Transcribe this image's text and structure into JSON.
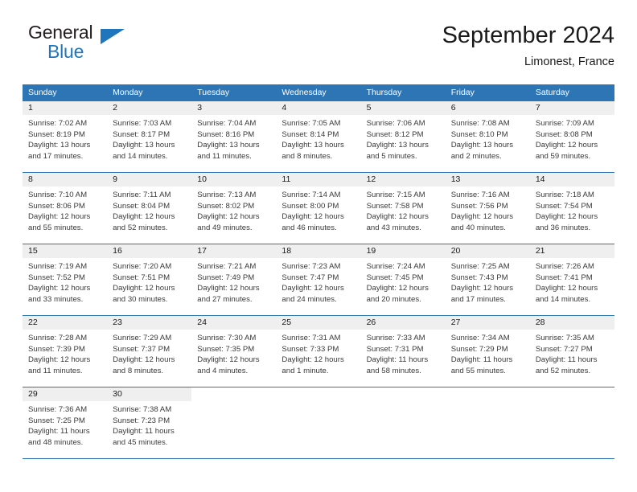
{
  "brand": {
    "name_part1": "General",
    "name_part2": "Blue",
    "logo_icon": "triangle-logo-icon"
  },
  "header": {
    "title": "September 2024",
    "location": "Limonest, France"
  },
  "calendar": {
    "weekday_headers": [
      "Sunday",
      "Monday",
      "Tuesday",
      "Wednesday",
      "Thursday",
      "Friday",
      "Saturday"
    ],
    "accent_color": "#2e75b6",
    "day_band_color": "#efefef",
    "weeks": [
      [
        {
          "day": "1",
          "lines": [
            "Sunrise: 7:02 AM",
            "Sunset: 8:19 PM",
            "Daylight: 13 hours",
            "and 17 minutes."
          ]
        },
        {
          "day": "2",
          "lines": [
            "Sunrise: 7:03 AM",
            "Sunset: 8:17 PM",
            "Daylight: 13 hours",
            "and 14 minutes."
          ]
        },
        {
          "day": "3",
          "lines": [
            "Sunrise: 7:04 AM",
            "Sunset: 8:16 PM",
            "Daylight: 13 hours",
            "and 11 minutes."
          ]
        },
        {
          "day": "4",
          "lines": [
            "Sunrise: 7:05 AM",
            "Sunset: 8:14 PM",
            "Daylight: 13 hours",
            "and 8 minutes."
          ]
        },
        {
          "day": "5",
          "lines": [
            "Sunrise: 7:06 AM",
            "Sunset: 8:12 PM",
            "Daylight: 13 hours",
            "and 5 minutes."
          ]
        },
        {
          "day": "6",
          "lines": [
            "Sunrise: 7:08 AM",
            "Sunset: 8:10 PM",
            "Daylight: 13 hours",
            "and 2 minutes."
          ]
        },
        {
          "day": "7",
          "lines": [
            "Sunrise: 7:09 AM",
            "Sunset: 8:08 PM",
            "Daylight: 12 hours",
            "and 59 minutes."
          ]
        }
      ],
      [
        {
          "day": "8",
          "lines": [
            "Sunrise: 7:10 AM",
            "Sunset: 8:06 PM",
            "Daylight: 12 hours",
            "and 55 minutes."
          ]
        },
        {
          "day": "9",
          "lines": [
            "Sunrise: 7:11 AM",
            "Sunset: 8:04 PM",
            "Daylight: 12 hours",
            "and 52 minutes."
          ]
        },
        {
          "day": "10",
          "lines": [
            "Sunrise: 7:13 AM",
            "Sunset: 8:02 PM",
            "Daylight: 12 hours",
            "and 49 minutes."
          ]
        },
        {
          "day": "11",
          "lines": [
            "Sunrise: 7:14 AM",
            "Sunset: 8:00 PM",
            "Daylight: 12 hours",
            "and 46 minutes."
          ]
        },
        {
          "day": "12",
          "lines": [
            "Sunrise: 7:15 AM",
            "Sunset: 7:58 PM",
            "Daylight: 12 hours",
            "and 43 minutes."
          ]
        },
        {
          "day": "13",
          "lines": [
            "Sunrise: 7:16 AM",
            "Sunset: 7:56 PM",
            "Daylight: 12 hours",
            "and 40 minutes."
          ]
        },
        {
          "day": "14",
          "lines": [
            "Sunrise: 7:18 AM",
            "Sunset: 7:54 PM",
            "Daylight: 12 hours",
            "and 36 minutes."
          ]
        }
      ],
      [
        {
          "day": "15",
          "lines": [
            "Sunrise: 7:19 AM",
            "Sunset: 7:52 PM",
            "Daylight: 12 hours",
            "and 33 minutes."
          ]
        },
        {
          "day": "16",
          "lines": [
            "Sunrise: 7:20 AM",
            "Sunset: 7:51 PM",
            "Daylight: 12 hours",
            "and 30 minutes."
          ]
        },
        {
          "day": "17",
          "lines": [
            "Sunrise: 7:21 AM",
            "Sunset: 7:49 PM",
            "Daylight: 12 hours",
            "and 27 minutes."
          ]
        },
        {
          "day": "18",
          "lines": [
            "Sunrise: 7:23 AM",
            "Sunset: 7:47 PM",
            "Daylight: 12 hours",
            "and 24 minutes."
          ]
        },
        {
          "day": "19",
          "lines": [
            "Sunrise: 7:24 AM",
            "Sunset: 7:45 PM",
            "Daylight: 12 hours",
            "and 20 minutes."
          ]
        },
        {
          "day": "20",
          "lines": [
            "Sunrise: 7:25 AM",
            "Sunset: 7:43 PM",
            "Daylight: 12 hours",
            "and 17 minutes."
          ]
        },
        {
          "day": "21",
          "lines": [
            "Sunrise: 7:26 AM",
            "Sunset: 7:41 PM",
            "Daylight: 12 hours",
            "and 14 minutes."
          ]
        }
      ],
      [
        {
          "day": "22",
          "lines": [
            "Sunrise: 7:28 AM",
            "Sunset: 7:39 PM",
            "Daylight: 12 hours",
            "and 11 minutes."
          ]
        },
        {
          "day": "23",
          "lines": [
            "Sunrise: 7:29 AM",
            "Sunset: 7:37 PM",
            "Daylight: 12 hours",
            "and 8 minutes."
          ]
        },
        {
          "day": "24",
          "lines": [
            "Sunrise: 7:30 AM",
            "Sunset: 7:35 PM",
            "Daylight: 12 hours",
            "and 4 minutes."
          ]
        },
        {
          "day": "25",
          "lines": [
            "Sunrise: 7:31 AM",
            "Sunset: 7:33 PM",
            "Daylight: 12 hours",
            "and 1 minute."
          ]
        },
        {
          "day": "26",
          "lines": [
            "Sunrise: 7:33 AM",
            "Sunset: 7:31 PM",
            "Daylight: 11 hours",
            "and 58 minutes."
          ]
        },
        {
          "day": "27",
          "lines": [
            "Sunrise: 7:34 AM",
            "Sunset: 7:29 PM",
            "Daylight: 11 hours",
            "and 55 minutes."
          ]
        },
        {
          "day": "28",
          "lines": [
            "Sunrise: 7:35 AM",
            "Sunset: 7:27 PM",
            "Daylight: 11 hours",
            "and 52 minutes."
          ]
        }
      ],
      [
        {
          "day": "29",
          "lines": [
            "Sunrise: 7:36 AM",
            "Sunset: 7:25 PM",
            "Daylight: 11 hours",
            "and 48 minutes."
          ]
        },
        {
          "day": "30",
          "lines": [
            "Sunrise: 7:38 AM",
            "Sunset: 7:23 PM",
            "Daylight: 11 hours",
            "and 45 minutes."
          ]
        },
        {
          "day": "",
          "lines": []
        },
        {
          "day": "",
          "lines": []
        },
        {
          "day": "",
          "lines": []
        },
        {
          "day": "",
          "lines": []
        },
        {
          "day": "",
          "lines": []
        }
      ]
    ]
  }
}
